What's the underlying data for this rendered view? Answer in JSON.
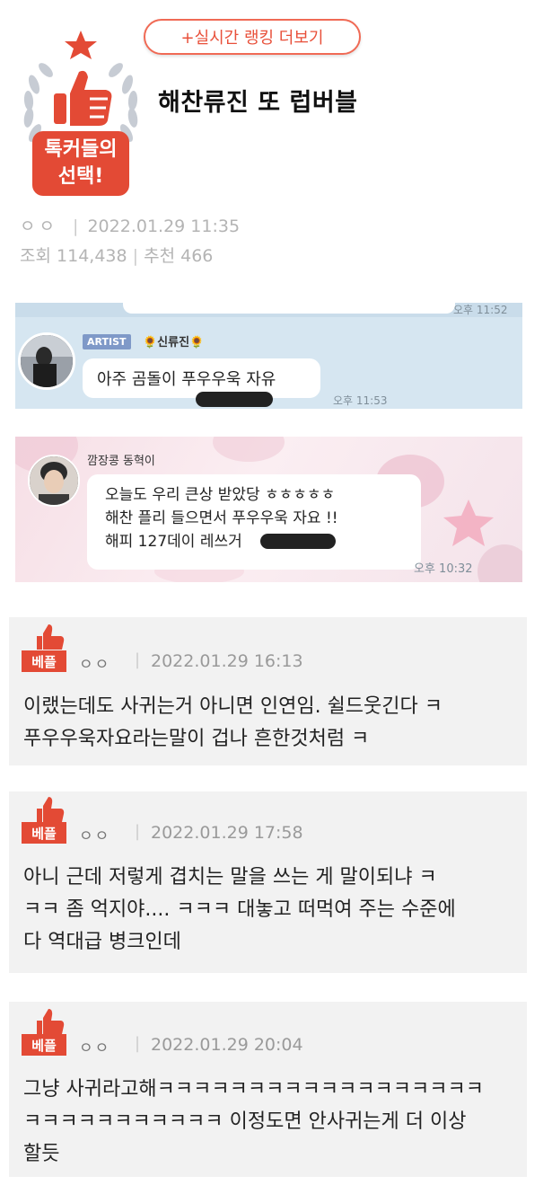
{
  "header": {
    "ranking_button": "+실시간 랭킹 더보기",
    "badge_line1": "톡커들의",
    "badge_line2": "선택!",
    "title": "해찬류진 또 럽버블",
    "author": "ㅇㅇ",
    "date": "2022.01.29 11:35",
    "views_label": "조회",
    "views": "114,438",
    "recommend_label": "추천",
    "recommends": "466"
  },
  "chat1": {
    "top_time": "오후 11:52",
    "artist_tag": "ARTIST",
    "sender": "🌻신류진🌻",
    "message": "아주 곰돌이 푸우우욱 자유",
    "time": "오후 11:53"
  },
  "chat2": {
    "sender": "깜장콩 동혁이",
    "lines": [
      "오늘도 우리 큰상 받았당 ㅎㅎㅎㅎㅎ",
      "해찬 플리 들으면서 푸우우욱 자요 !!",
      "해피 127데이 레쓰거"
    ],
    "time": "오후 10:32"
  },
  "comments": [
    {
      "badge": "베플",
      "author": "ㅇㅇ",
      "date": "2022.01.29 16:13",
      "body_lines": [
        "이랬는데도 사귀는거 아니면 인연임. 쉴드웃긴다 ㅋ",
        "푸우우욱자요라는말이 겁나 흔한것처럼 ㅋ"
      ]
    },
    {
      "badge": "베플",
      "author": "ㅇㅇ",
      "date": "2022.01.29 17:58",
      "body_lines": [
        "아니 근데 저렇게 겹치는 말을 쓰는 게 말이되냐 ㅋ",
        "ㅋㅋ 좀 억지야.... ㅋㅋㅋ 대놓고 떠먹여 주는 수준에",
        "다 역대급 병크인데"
      ]
    },
    {
      "badge": "베플",
      "author": "ㅇㅇ",
      "date": "2022.01.29 20:04",
      "body_lines": [
        "그냥 사귀라고해ㅋㅋㅋㅋㅋㅋㅋㅋㅋㅋㅋㅋㅋㅋㅋㅋㅋㅋ",
        "ㅋㅋㅋㅋㅋㅋㅋㅋㅋㅋㅋ 이정도면 안사귀는게 더 이상",
        "할듯"
      ]
    }
  ],
  "colors": {
    "accent": "#e34a35",
    "chat1_bg": "#d6e6f1",
    "comment_bg": "#f2f2f2"
  }
}
